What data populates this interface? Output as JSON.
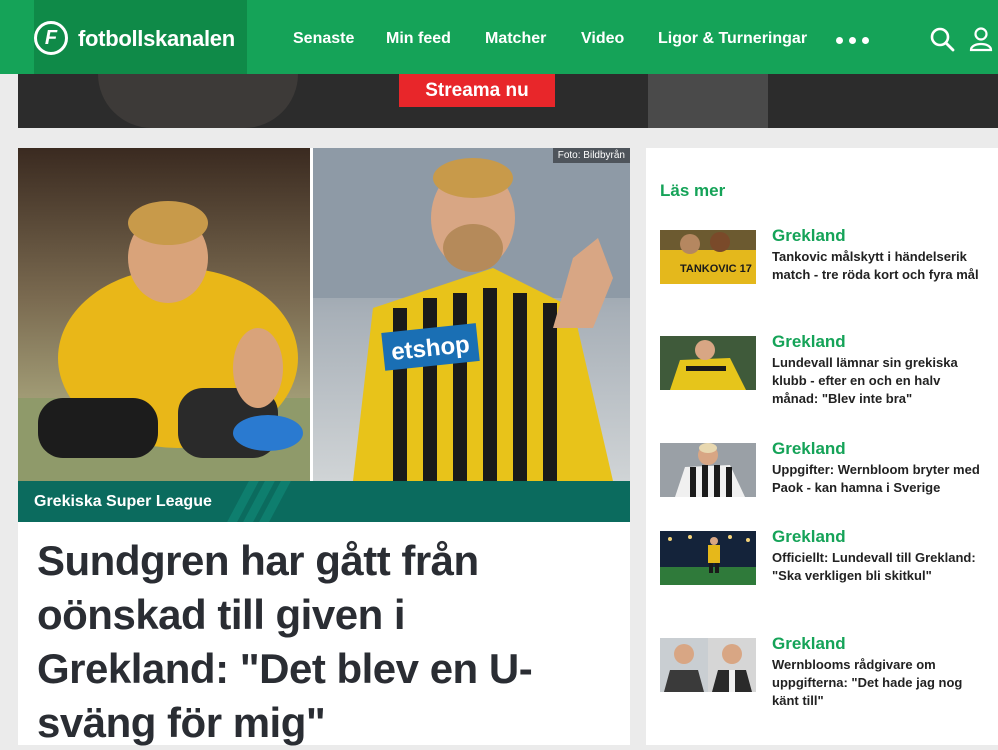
{
  "brand": {
    "name": "fotbollskanalen",
    "logo_letter": "F",
    "accent": "#15a358",
    "dark": "#0f8a48"
  },
  "nav": {
    "items": [
      "Senaste",
      "Min feed",
      "Matcher",
      "Video",
      "Ligor & Turneringar"
    ]
  },
  "banner": {
    "cta": "Streama nu",
    "cta_color": "#e8262a"
  },
  "hero": {
    "photo_credit": "Foto: Bildbyrån",
    "category": "Grekiska Super League",
    "headline": "Sundgren har gått från oönskad till given i Grekland: \"Det blev en U-sväng för mig\""
  },
  "sidebar": {
    "title": "Läs mer",
    "items": [
      {
        "category": "Grekland",
        "title": "Tankovic målskytt i händelserik match - tre röda kort och fyra mål",
        "thumb_text": "TANKOVIC 17"
      },
      {
        "category": "Grekland",
        "title": "Lundevall lämnar sin grekiska klubb - efter en och en halv månad: \"Blev inte bra\""
      },
      {
        "category": "Grekland",
        "title": "Uppgifter: Wernbloom bryter med Paok - kan hamna i Sverige"
      },
      {
        "category": "Grekland",
        "title": "Officiellt: Lundevall till Grekland: \"Ska verkligen bli skitkul\""
      },
      {
        "category": "Grekland",
        "title": "Wernblooms rådgivare om uppgifterna: \"Det hade jag nog känt till\""
      }
    ]
  },
  "icons": {
    "search": "search-icon",
    "user": "user-icon",
    "more": "more-dots-icon"
  }
}
